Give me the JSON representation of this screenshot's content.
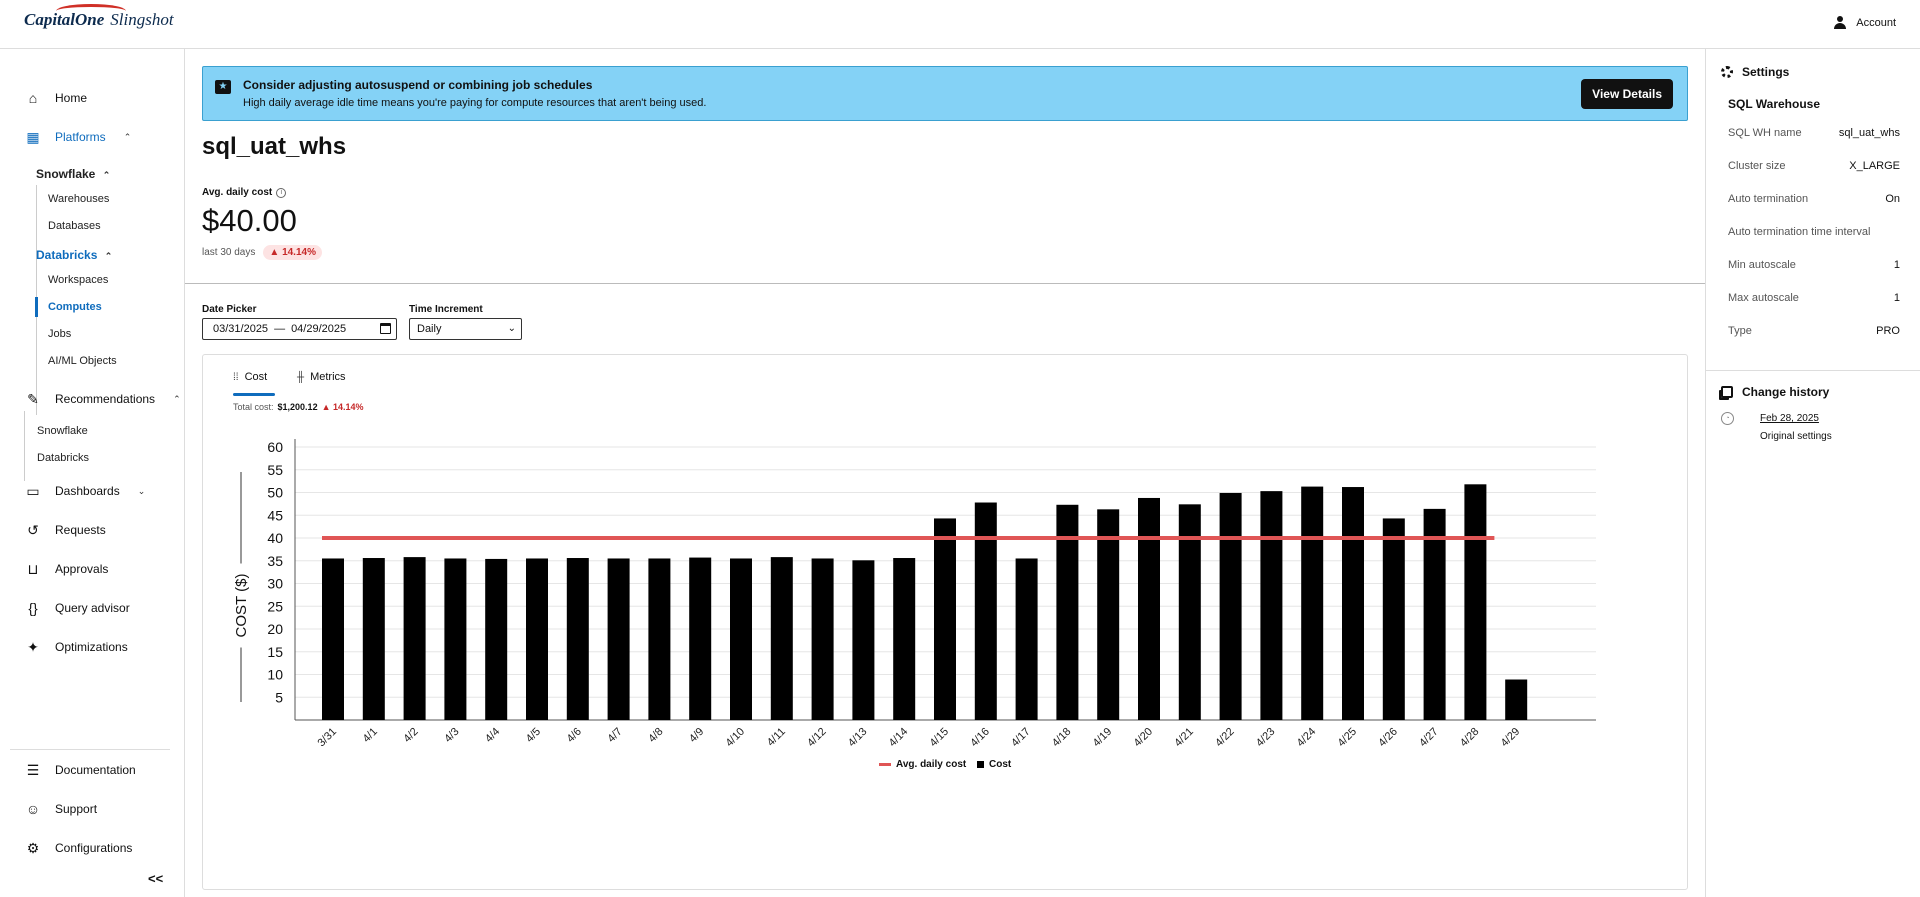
{
  "header": {
    "brand": "CapitalOne",
    "product": "Slingshot",
    "account_label": "Account"
  },
  "sidebar": {
    "home": "Home",
    "platforms": "Platforms",
    "snowflake": "Snowflake",
    "snowflake_items": [
      "Warehouses",
      "Databases"
    ],
    "databricks": "Databricks",
    "databricks_items": [
      "Workspaces",
      "Computes",
      "Jobs",
      "AI/ML Objects"
    ],
    "recommendations": "Recommendations",
    "recommendations_items": [
      "Snowflake",
      "Databricks"
    ],
    "dashboards": "Dashboards",
    "requests": "Requests",
    "approvals": "Approvals",
    "query_advisor": "Query advisor",
    "optimizations": "Optimizations",
    "documentation": "Documentation",
    "support": "Support",
    "configurations": "Configurations",
    "collapse_glyph": "<<"
  },
  "banner": {
    "title": "Consider adjusting autosuspend or combining job schedules",
    "description": "High daily average idle time means you're paying for compute resources that aren't being used.",
    "button": "View Details"
  },
  "warehouse": {
    "name": "sql_uat_whs",
    "avg_label": "Avg. daily cost",
    "avg_value": "$40.00",
    "period": "last 30 days",
    "delta": "14.14%"
  },
  "filters": {
    "date_label": "Date Picker",
    "date_start": "03/31/2025",
    "date_sep": "—",
    "date_end": "04/29/2025",
    "increment_label": "Time Increment",
    "increment_value": "Daily"
  },
  "chart_tabs": {
    "cost": "Cost",
    "metrics": "Metrics"
  },
  "total": {
    "label": "Total cost:",
    "amount": "$1,200.12",
    "delta": "14.14%"
  },
  "chart_data": {
    "type": "bar",
    "ylabel": "COST ($)",
    "xlabel": "",
    "ylim": [
      0,
      60
    ],
    "yticks": [
      5,
      10,
      15,
      20,
      25,
      30,
      35,
      40,
      45,
      50,
      55,
      60
    ],
    "grid": true,
    "legend_position": "bottom-center",
    "categories": [
      "3/31",
      "4/1",
      "4/2",
      "4/3",
      "4/4",
      "4/5",
      "4/6",
      "4/7",
      "4/8",
      "4/9",
      "4/10",
      "4/11",
      "4/12",
      "4/13",
      "4/14",
      "4/15",
      "4/16",
      "4/17",
      "4/18",
      "4/19",
      "4/20",
      "4/21",
      "4/22",
      "4/23",
      "4/24",
      "4/25",
      "4/26",
      "4/27",
      "4/28",
      "4/29"
    ],
    "series": [
      {
        "name": "Cost",
        "type": "bar",
        "color": "#000000",
        "values": [
          35.5,
          35.6,
          35.8,
          35.5,
          35.4,
          35.5,
          35.6,
          35.5,
          35.5,
          35.7,
          35.5,
          35.8,
          35.5,
          35.1,
          35.6,
          44.3,
          47.8,
          35.5,
          47.3,
          46.3,
          48.8,
          47.4,
          49.9,
          50.3,
          51.3,
          51.2,
          44.3,
          46.4,
          51.8,
          8.9
        ]
      },
      {
        "name": "Avg. daily cost",
        "type": "line",
        "color": "#e05555",
        "value": 40
      }
    ]
  },
  "settings": {
    "title": "Settings",
    "section": "SQL Warehouse",
    "rows": [
      {
        "key": "SQL WH name",
        "value": "sql_uat_whs"
      },
      {
        "key": "Cluster size",
        "value": "X_LARGE"
      },
      {
        "key": "Auto termination",
        "value": "On"
      },
      {
        "key": "Auto termination time interval",
        "value": ""
      },
      {
        "key": "Min autoscale",
        "value": "1"
      },
      {
        "key": "Max autoscale",
        "value": "1"
      },
      {
        "key": "Type",
        "value": "PRO"
      }
    ]
  },
  "history": {
    "title": "Change history",
    "date": "Feb 28, 2025",
    "note": "Original settings"
  }
}
